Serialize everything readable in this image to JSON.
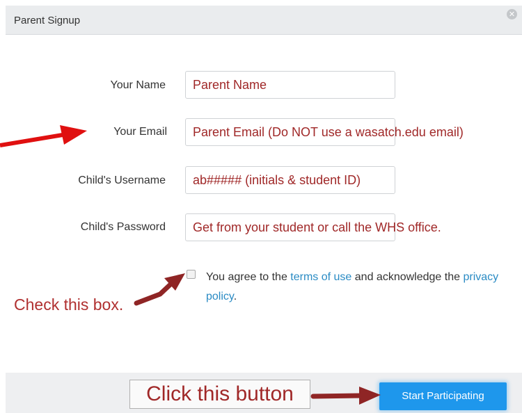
{
  "dialog": {
    "title": "Parent Signup"
  },
  "form": {
    "name_label": "Your Name",
    "name_value": "Parent Name",
    "email_label": "Your Email",
    "email_value": "Parent Email (Do NOT use a wasatch.edu email)",
    "username_label": "Child's Username",
    "username_value": "ab##### (initials & student ID)",
    "password_label": "Child's Password",
    "password_value": "Get from your student or call the WHS office."
  },
  "agreement": {
    "prefix": "You agree to the",
    "terms_link": "terms of use",
    "middle": "and acknowledge the",
    "privacy_link": "privacy policy",
    "suffix": "."
  },
  "annotations": {
    "check_note": "Check this box.",
    "click_note": "Click this button"
  },
  "footer": {
    "submit_label": "Start Participating"
  },
  "colors": {
    "accent": "#1e97ec",
    "annotation": "#b03030",
    "link": "#2a8bc4",
    "arrow": "#e01010"
  },
  "icons": {
    "close": "close-icon"
  }
}
